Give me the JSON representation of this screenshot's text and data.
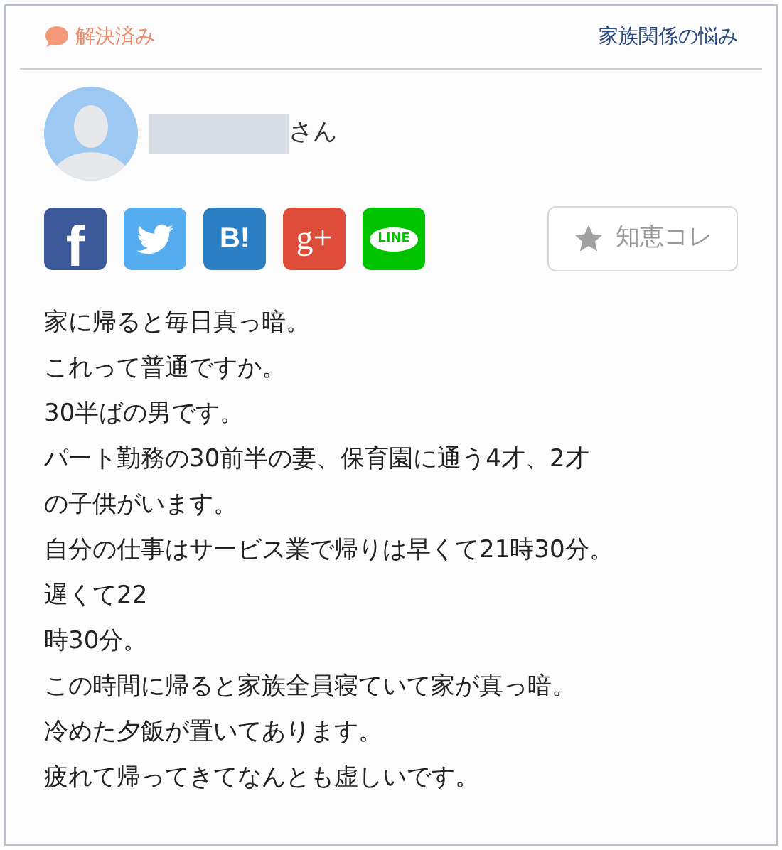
{
  "status": {
    "label": "解決済み"
  },
  "category": "家族関係の悩み",
  "user": {
    "name_suffix": "さん"
  },
  "share_buttons": [
    {
      "kind": "facebook",
      "label": "f"
    },
    {
      "kind": "twitter"
    },
    {
      "kind": "hatena",
      "label": "B!"
    },
    {
      "kind": "googleplus",
      "label": "g+"
    },
    {
      "kind": "line",
      "label": "LINE"
    }
  ],
  "bookmark_button": {
    "label": "知恵コレ"
  },
  "body_lines": [
    "家に帰ると毎日真っ暗。",
    "これって普通ですか。",
    "30半ばの男です。",
    "パート勤務の30前半の妻、保育園に通う4才、2才",
    "の子供がいます。",
    "自分の仕事はサービス業で帰りは早くて21時30分。",
    "遅くて22",
    "時30分。",
    "この時間に帰ると家族全員寝ていて家が真っ暗。",
    "冷めた夕飯が置いてあります。",
    "疲れて帰ってきてなんとも虚しいです。"
  ]
}
